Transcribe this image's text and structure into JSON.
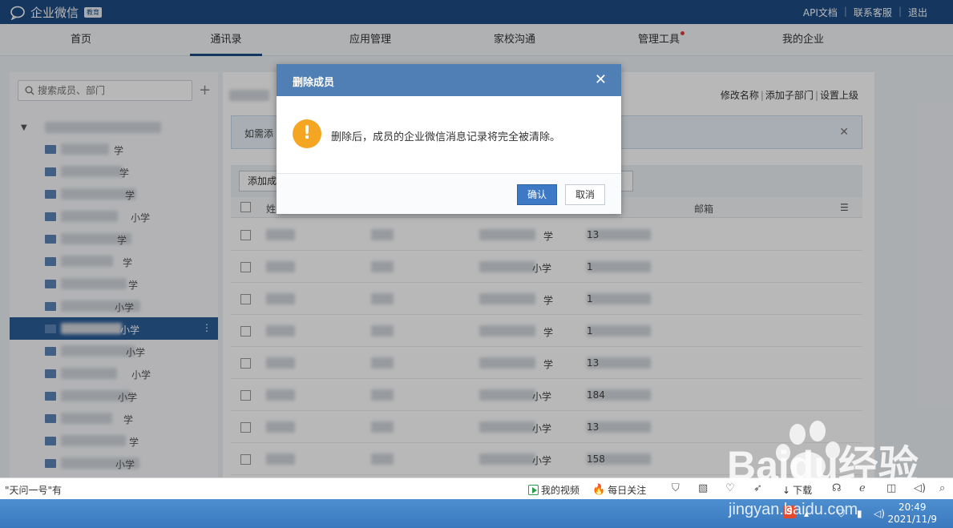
{
  "app": {
    "name": "企业微信",
    "badge": "教育"
  },
  "toplinks": [
    "API文档",
    "联系客服",
    "退出"
  ],
  "nav": [
    "首页",
    "通讯录",
    "应用管理",
    "家校沟通",
    "管理工具",
    "我的企业"
  ],
  "sidebar": {
    "search_placeholder": "搜索成员、部门",
    "tree_labels": [
      "学",
      "学",
      "学",
      "小学",
      "学",
      "学",
      "学",
      "小学",
      "小学",
      "小学",
      "小学",
      "小学",
      "学",
      "学",
      "小学"
    ]
  },
  "main": {
    "actions": [
      "修改名称",
      "添加子部门",
      "设置上级"
    ],
    "notice": "如需添",
    "add_button": "添加成",
    "columns": {
      "name": "姓",
      "email": "邮箱"
    },
    "rows": [
      {
        "school": "学",
        "phone": "13"
      },
      {
        "school": "小学",
        "phone": "1"
      },
      {
        "school": "学",
        "phone": "1"
      },
      {
        "school": "学",
        "phone": "1"
      },
      {
        "school": "学",
        "phone": "13"
      },
      {
        "school": "小学",
        "phone": "184"
      },
      {
        "school": "小学",
        "phone": "13"
      },
      {
        "school": "小学",
        "phone": "158"
      }
    ]
  },
  "dialog": {
    "title": "删除成员",
    "message": "删除后，成员的企业微信消息记录将完全被清除。",
    "ok": "确认",
    "cancel": "取消"
  },
  "statusbar": {
    "news": "\"天问一号\"有",
    "video": "我的视频",
    "follow": "每日关注",
    "download": "下载"
  },
  "taskbar": {
    "time": "20:49",
    "date": "2021/11/9",
    "ime": "S"
  },
  "watermark": {
    "brand": "Baidu经验",
    "url": "jingyan.baidu.com"
  },
  "colors": {
    "topbar": "#1c4c84",
    "dialog_header": "#4f7fb4",
    "warn": "#f4a623",
    "primary": "#3d79c4"
  }
}
